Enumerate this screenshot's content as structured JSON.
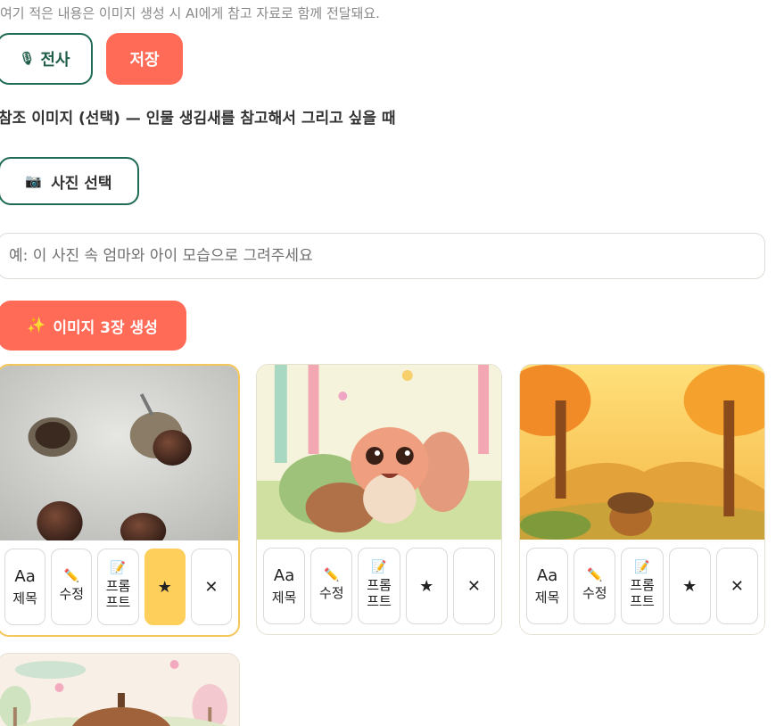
{
  "hint": "여기 적은 내용은 이미지 생성 시 AI에게 참고 자료로 함께 전달돼요.",
  "buttons": {
    "transcribe_icon": "🎙",
    "transcribe_label": "전사",
    "save_label": "저장",
    "photo_icon": "📷",
    "photo_label": "사진 선택",
    "generate_icon": "✨",
    "generate_label": "이미지 3장 생성"
  },
  "reference": {
    "title": "참조 이미지 (선택) — 인물 생김새를 참고해서 그리고 싶을 때",
    "placeholder": "예: 이 사진 속 엄마와 아이 모습으로 그려주세요"
  },
  "card_actions": {
    "title_icon": "Aa",
    "title_label": "제목",
    "edit_icon": "✏️",
    "edit_label": "수정",
    "prompt_icon": "📝",
    "prompt_label_1": "프롬",
    "prompt_label_2": "프트",
    "star": "★",
    "delete": "✕"
  },
  "cards": [
    {
      "subject": "acorns-photo",
      "starred": true
    },
    {
      "subject": "squirrel-with-acorn",
      "starred": false
    },
    {
      "subject": "autumn-forest-acorn",
      "starred": false
    },
    {
      "subject": "pastel-acorn",
      "starred": false
    }
  ],
  "colors": {
    "accent_coral": "#ff6b57",
    "accent_green": "#1f6b55",
    "star_yellow": "#ffcf5c"
  }
}
